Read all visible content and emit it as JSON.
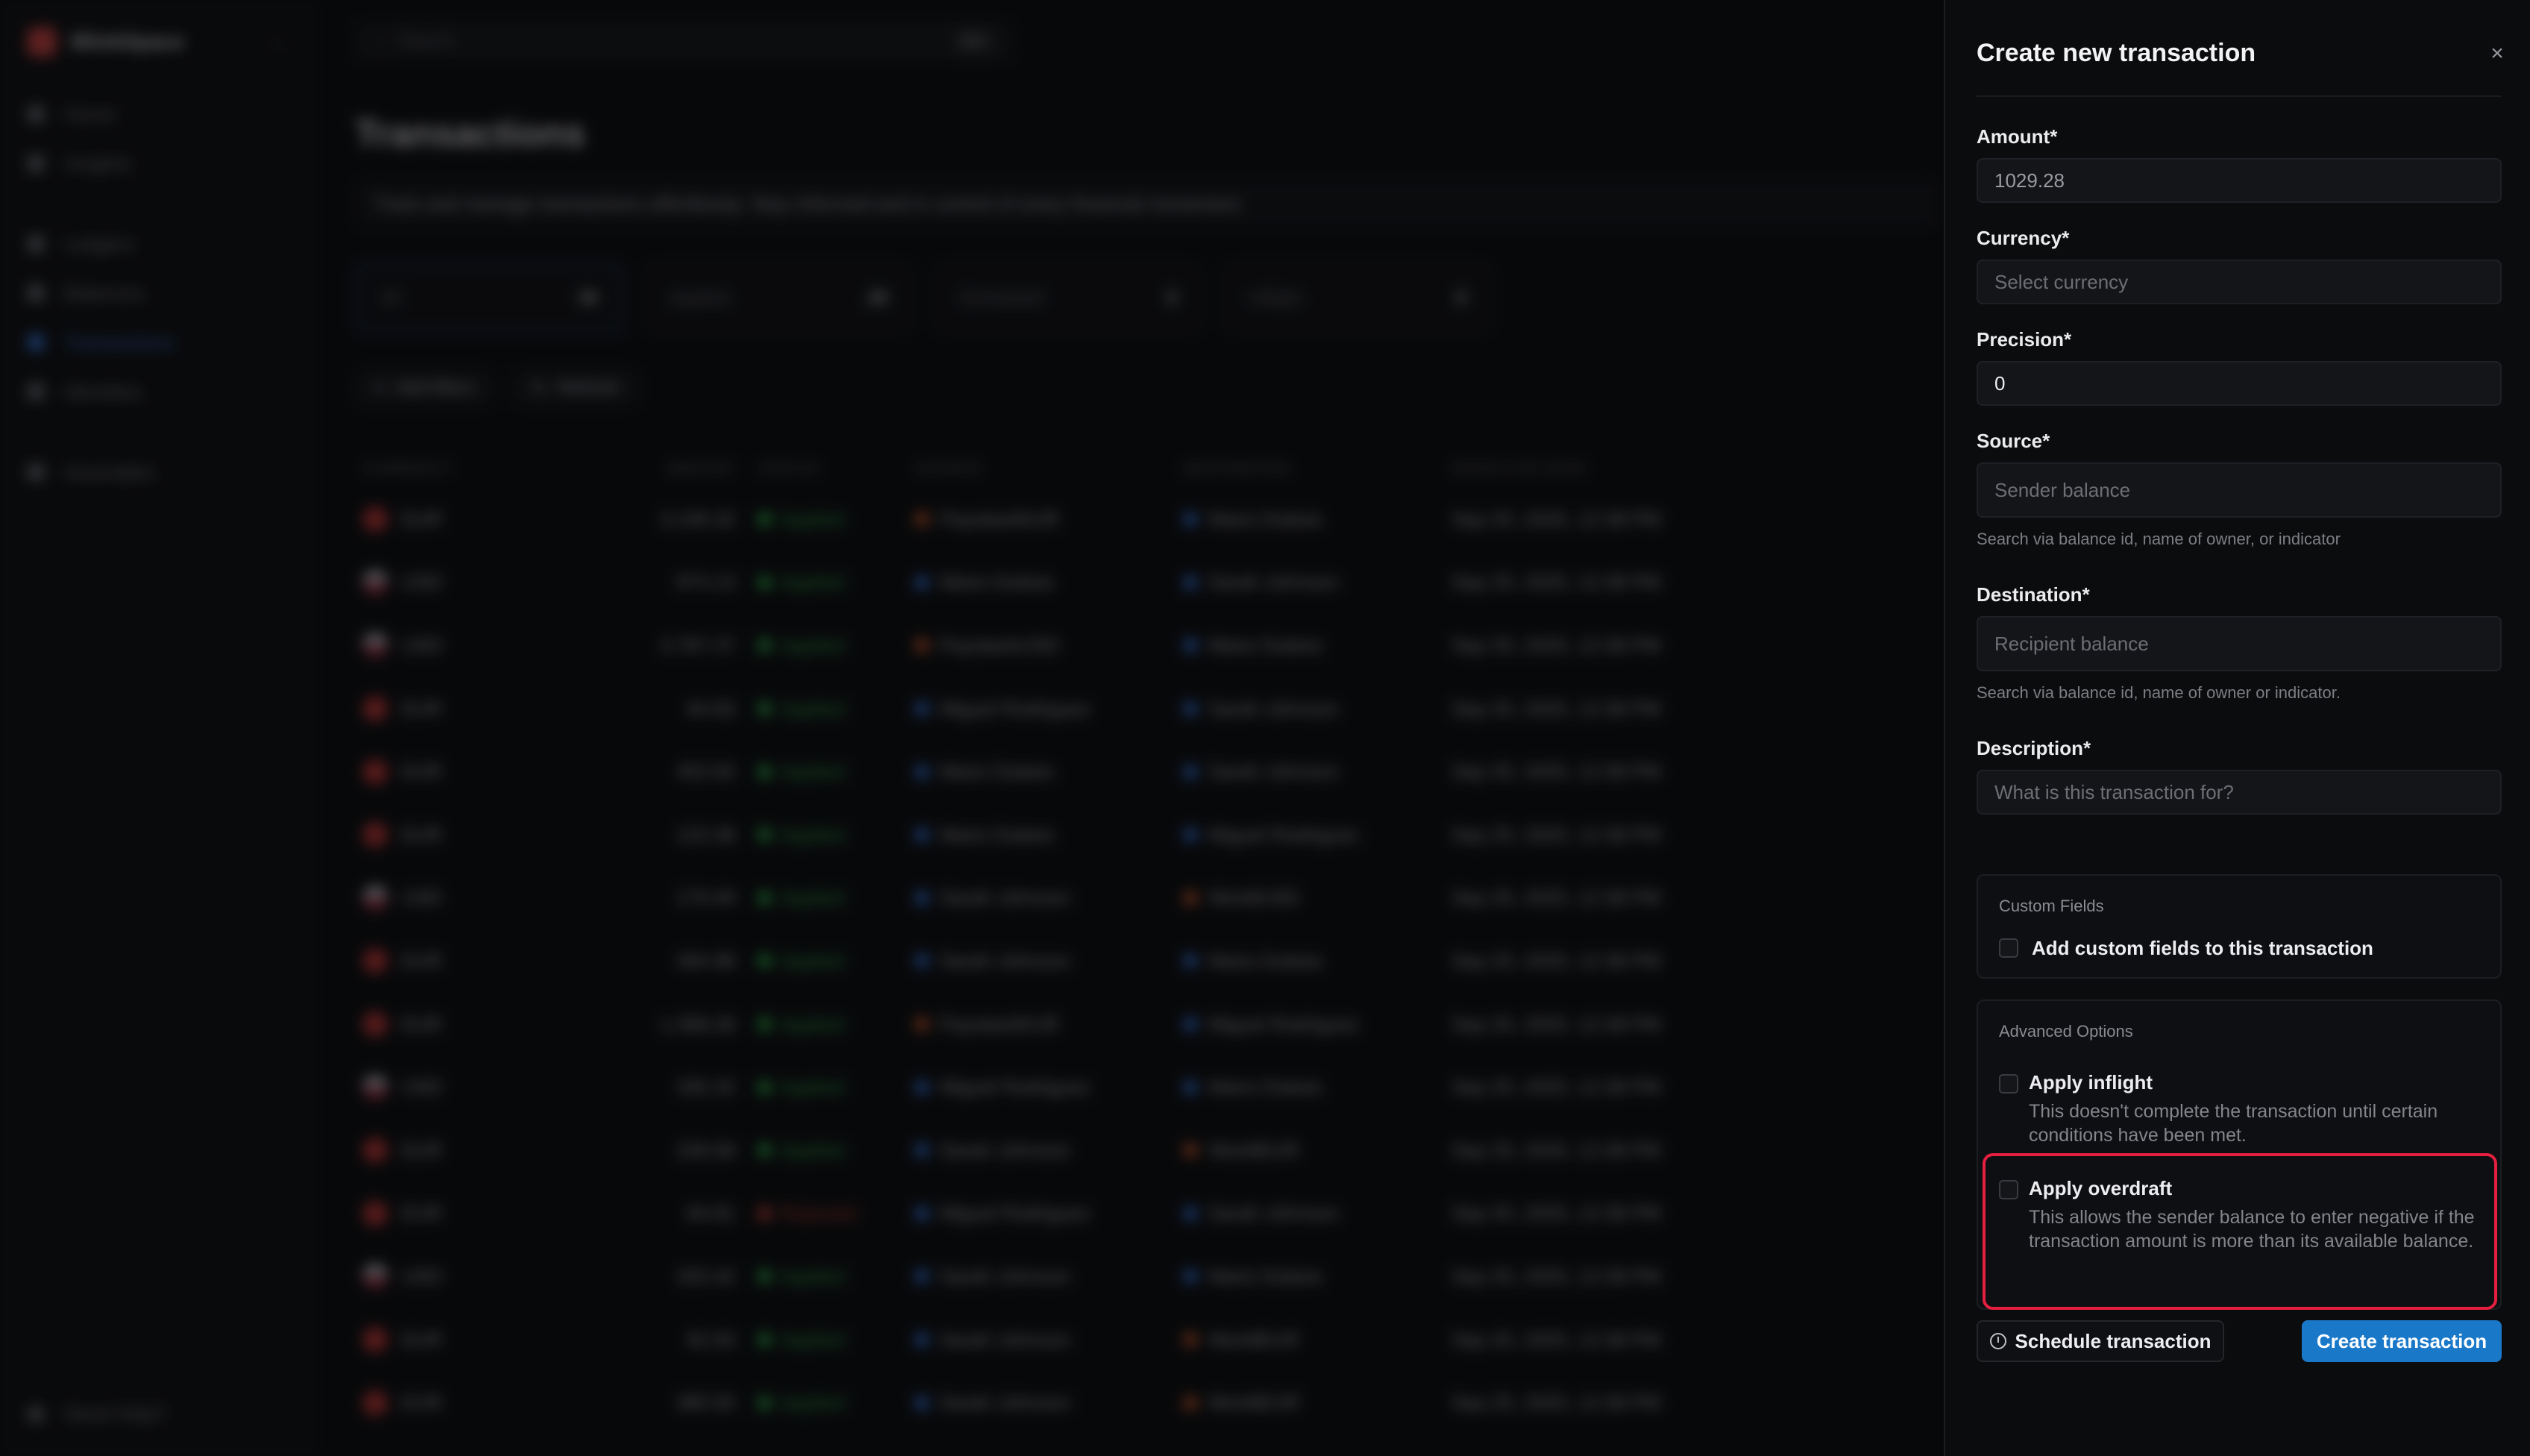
{
  "sidebar": {
    "brand": "BlinkSpace",
    "items": [
      {
        "label": "Home"
      },
      {
        "label": "Insights"
      },
      {
        "label": "Ledgers"
      },
      {
        "label": "Balances"
      },
      {
        "label": "Transactions"
      },
      {
        "label": "Identities"
      },
      {
        "label": "Anomalies"
      }
    ],
    "help": "Need Help?"
  },
  "main": {
    "search_placeholder": "Search",
    "search_shortcut": "⌘K",
    "title": "Transactions",
    "description": "Track and manage transactions effortlessly. Stay informed and in control of every financial movement.",
    "stats": [
      {
        "label": "All",
        "count": "30"
      },
      {
        "label": "Applied",
        "count": "29"
      },
      {
        "label": "Scheduled",
        "count": "0"
      },
      {
        "label": "Inflight",
        "count": "0"
      }
    ],
    "actions": [
      {
        "label": "Add filters"
      },
      {
        "label": "Refresh"
      }
    ],
    "table": {
      "headers": [
        "Currency",
        "Amount",
        "Status",
        "Source",
        "Destination",
        "Effective Date"
      ],
      "rows": [
        {
          "currency": "EUR",
          "amount": "3,109.32",
          "status": "Applied",
          "source": "PaystackEUR",
          "destination": "Mario Dubois",
          "date": "Sep 25, 2025, 12:38 PM"
        },
        {
          "currency": "USD",
          "amount": "974.13",
          "status": "Applied",
          "source": "Mario Dubois",
          "destination": "Sarah Johnson",
          "date": "Sep 25, 2025, 12:38 PM"
        },
        {
          "currency": "USD",
          "amount": "3,787.37",
          "status": "Applied",
          "source": "PaystackUSD",
          "destination": "Mario Dubois",
          "date": "Sep 25, 2025, 12:38 PM"
        },
        {
          "currency": "EUR",
          "amount": "94.83",
          "status": "Applied",
          "source": "Miguel Rodriguez",
          "destination": "Sarah Johnson",
          "date": "Sep 25, 2025, 12:38 PM"
        },
        {
          "currency": "EUR",
          "amount": "453.92",
          "status": "Applied",
          "source": "Mario Dubois",
          "destination": "Sarah Johnson",
          "date": "Sep 25, 2025, 12:38 PM"
        },
        {
          "currency": "EUR",
          "amount": "123.38",
          "status": "Applied",
          "source": "Mario Dubois",
          "destination": "Miguel Rodriguez",
          "date": "Sep 25, 2025, 12:38 PM"
        },
        {
          "currency": "USD",
          "amount": "179.49",
          "status": "Applied",
          "source": "Sarah Johnson",
          "destination": "WorldUSD",
          "date": "Sep 25, 2025, 12:38 PM"
        },
        {
          "currency": "EUR",
          "amount": "494.98",
          "status": "Applied",
          "source": "Sarah Johnson",
          "destination": "Mario Dubois",
          "date": "Sep 25, 2025, 12:38 PM"
        },
        {
          "currency": "EUR",
          "amount": "1,398.28",
          "status": "Applied",
          "source": "PaystackEUR",
          "destination": "Miguel Rodriguez",
          "date": "Sep 25, 2025, 12:38 PM"
        },
        {
          "currency": "USD",
          "amount": "335.32",
          "status": "Applied",
          "source": "Miguel Rodriguez",
          "destination": "Mario Dubois",
          "date": "Sep 25, 2025, 12:38 PM"
        },
        {
          "currency": "EUR",
          "amount": "228.58",
          "status": "Applied",
          "source": "Sarah Johnson",
          "destination": "WorldEUR",
          "date": "Sep 25, 2025, 12:38 PM"
        },
        {
          "currency": "EUR",
          "amount": "84.81",
          "status": "Rejected",
          "source": "Miguel Rodriguez",
          "destination": "Sarah Johnson",
          "date": "Sep 25, 2025, 12:38 PM"
        },
        {
          "currency": "USD",
          "amount": "333.42",
          "status": "Applied",
          "source": "Sarah Johnson",
          "destination": "Mario Dubois",
          "date": "Sep 25, 2025, 12:38 PM"
        },
        {
          "currency": "EUR",
          "amount": "92.93",
          "status": "Applied",
          "source": "Sarah Johnson",
          "destination": "WorldEUR",
          "date": "Sep 25, 2025, 12:38 PM"
        },
        {
          "currency": "EUR",
          "amount": "380.55",
          "status": "Applied",
          "source": "Sarah Johnson",
          "destination": "WorldEUR",
          "date": "Sep 25, 2025, 12:38 PM"
        }
      ]
    }
  },
  "drawer": {
    "title": "Create new transaction",
    "close_icon": "×",
    "amount": {
      "label": "Amount*",
      "value": "1029.28"
    },
    "currency": {
      "label": "Currency*",
      "placeholder": "Select currency"
    },
    "precision": {
      "label": "Precision*",
      "value": "0"
    },
    "source": {
      "label": "Source*",
      "placeholder": "Sender balance",
      "hint": "Search via balance id, name of owner, or indicator"
    },
    "destination": {
      "label": "Destination*",
      "placeholder": "Recipient balance",
      "hint": "Search via balance id, name of owner or indicator."
    },
    "description": {
      "label": "Description*",
      "placeholder": "What is this transaction for?"
    },
    "custom_fields": {
      "title": "Custom Fields",
      "checkbox_label": "Add custom fields to this transaction"
    },
    "advanced": {
      "title": "Advanced Options",
      "inflight": {
        "label": "Apply inflight",
        "description": "This doesn't complete the transaction until certain conditions have been met."
      },
      "overdraft": {
        "label": "Apply overdraft",
        "description": "This allows the sender balance to enter negative if the transaction amount is more than its available balance."
      }
    },
    "schedule_button": "Schedule transaction",
    "create_button": "Create transaction"
  },
  "colors": {
    "accent": "#1a78c9",
    "highlight": "#e51f3f",
    "applied": "#34c05a",
    "rejected": "#e0473c"
  },
  "icons": [
    "close-icon",
    "clock-icon",
    "search-icon",
    "checkbox-icon"
  ]
}
